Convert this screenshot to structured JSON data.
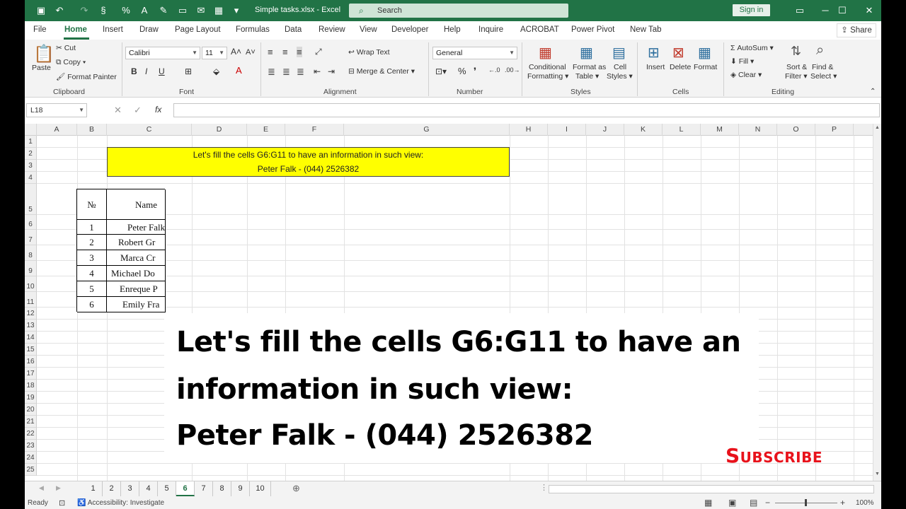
{
  "window": {
    "title": "Simple tasks.xlsx  -  Excel",
    "search_placeholder": "Search",
    "signin": "Sign in",
    "share": "Share"
  },
  "menu": [
    "File",
    "Home",
    "Insert",
    "Draw",
    "Page Layout",
    "Formulas",
    "Data",
    "Review",
    "View",
    "Developer",
    "Help",
    "Inquire",
    "ACROBAT",
    "Power Pivot",
    "New Tab"
  ],
  "ribbon": {
    "clipboard": {
      "label": "Clipboard",
      "paste": "Paste",
      "cut": "Cut",
      "copy": "Copy",
      "format_painter": "Format Painter"
    },
    "font": {
      "label": "Font",
      "name": "Calibri",
      "size": "11",
      "bold": "B",
      "italic": "I",
      "underline": "U"
    },
    "alignment": {
      "label": "Alignment",
      "wrap": "Wrap Text",
      "merge": "Merge & Center"
    },
    "number": {
      "label": "Number",
      "format": "General"
    },
    "styles": {
      "label": "Styles",
      "cond1": "Conditional",
      "cond2": "Formatting",
      "fmt1": "Format as",
      "fmt2": "Table",
      "cell1": "Cell",
      "cell2": "Styles"
    },
    "cells": {
      "label": "Cells",
      "insert": "Insert",
      "delete": "Delete",
      "format": "Format"
    },
    "editing": {
      "label": "Editing",
      "autosum": "AutoSum",
      "fill": "Fill",
      "clear": "Clear",
      "sort1": "Sort &",
      "sort2": "Filter",
      "find1": "Find &",
      "find2": "Select"
    }
  },
  "formula_bar": {
    "name_box": "L18",
    "fx": "fx"
  },
  "columns": [
    "A",
    "B",
    "C",
    "D",
    "E",
    "F",
    "G",
    "H",
    "I",
    "J",
    "K",
    "L",
    "M",
    "N",
    "O",
    "P"
  ],
  "rows": [
    "1",
    "2",
    "3",
    "4",
    "5",
    "6",
    "7",
    "8",
    "9",
    "10",
    "11",
    "12",
    "13",
    "14",
    "15",
    "16",
    "17",
    "18",
    "19",
    "20",
    "21",
    "22",
    "23",
    "24",
    "25"
  ],
  "banner": {
    "line1": "Let's fill the cells G6:G11 to have an information in such view:",
    "line2": "Peter Falk - (044) 2526382"
  },
  "table": {
    "header_no": "№",
    "header_name": "Name",
    "rows": [
      {
        "no": "1",
        "name": "Peter Falk"
      },
      {
        "no": "2",
        "name": "Robert Gr"
      },
      {
        "no": "3",
        "name": "Marca Cr"
      },
      {
        "no": "4",
        "name": "Michael Do"
      },
      {
        "no": "5",
        "name": "Enreque P"
      },
      {
        "no": "6",
        "name": "Emily Fra"
      }
    ]
  },
  "overlay": {
    "line1": "Let's fill the cells G6:G11 to have an",
    "line2": "information in such view:",
    "line3": "Peter Falk - (044) 2526382"
  },
  "subscribe": "Subscribe",
  "sheets": [
    "1",
    "2",
    "3",
    "4",
    "5",
    "6",
    "7",
    "8",
    "9",
    "10"
  ],
  "active_sheet": "6",
  "status": {
    "ready": "Ready",
    "accessibility": "Accessibility: Investigate",
    "zoom": "100%"
  },
  "colors": {
    "excel_green": "#217346",
    "highlight": "#ffff00",
    "subscribe_red": "#e8121b"
  }
}
